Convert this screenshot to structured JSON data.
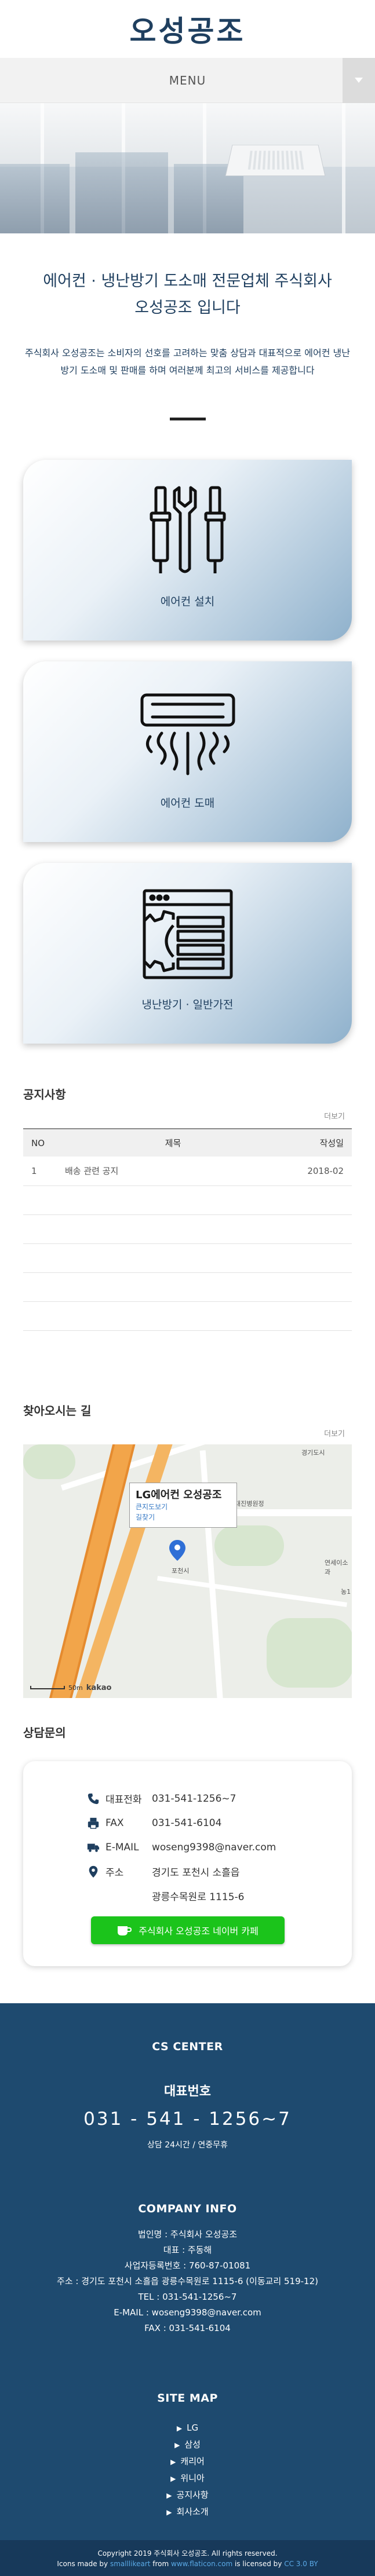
{
  "header": {
    "logo": "오성공조",
    "menu_label": "MENU"
  },
  "intro": {
    "title": "에어컨 · 냉난방기 도소매 전문업체 주식회사 오성공조 입니다",
    "description": "주식회사 오성공조는 소비자의 선호를 고려하는 맞춤 상담과 대표적으로 에어컨 냉난방기 도소매 및 판매를 하며 여러분께 최고의 서비스를 제공합니다"
  },
  "services": [
    {
      "label": "에어컨 설치",
      "icon": "tools-icon"
    },
    {
      "label": "에어컨 도매",
      "icon": "air-conditioner-icon"
    },
    {
      "label": "냉난방기 · 일반가전",
      "icon": "gear-window-icon"
    }
  ],
  "notice": {
    "title": "공지사항",
    "more": "더보기",
    "columns": {
      "no": "NO",
      "title": "제목",
      "date": "작성일"
    },
    "rows": [
      {
        "no": "1",
        "title": "배송 관련 공지",
        "date": "2018-02"
      },
      {
        "no": "",
        "title": "",
        "date": ""
      },
      {
        "no": "",
        "title": "",
        "date": ""
      },
      {
        "no": "",
        "title": "",
        "date": ""
      },
      {
        "no": "",
        "title": "",
        "date": ""
      },
      {
        "no": "",
        "title": "",
        "date": ""
      }
    ]
  },
  "location": {
    "title": "찾아오시는 길",
    "more": "더보기",
    "map": {
      "popup_title": "LG에어컨 오성공조",
      "popup_link_1": "큰지도보기",
      "popup_link_2": "길찾기",
      "places": [
        "경기도시",
        "대진병원정",
        "연세이소과",
        "농1",
        "포천시"
      ],
      "scale": "50m",
      "provider": "kakao"
    }
  },
  "contact": {
    "title": "상담문의",
    "phone_label": "대표전화",
    "phone": "031-541-1256~7",
    "fax_label": "FAX",
    "fax": "031-541-6104",
    "email_label": "E-MAIL",
    "email": "woseng9398@naver.com",
    "address_label": "주소",
    "address_1": "경기도 포천시 소흘읍",
    "address_2": "광릉수목원로 1115-6",
    "cafe_button": "주식회사 오성공조 네이버 카페"
  },
  "footer": {
    "cs_title": "CS CENTER",
    "tel_title": "대표번호",
    "tel": "031 - 541 - 1256~7",
    "hours": "상담 24시간 / 연중무휴",
    "company_title": "COMPANY INFO",
    "company_lines": [
      "법인명 : 주식회사 오성공조",
      "대표 : 주동해",
      "사업자등록번호 : 760-87-01081",
      "주소 : 경기도 포천시 소흘읍 광릉수목원로 1115-6 (이동교리 519-12)",
      "TEL : 031-541-1256~7",
      "E-MAIL : woseng9398@naver.com",
      "FAX : 031-541-6104"
    ],
    "sitemap_title": "SITE MAP",
    "sitemap": [
      "LG",
      "삼성",
      "캐리어",
      "위니아",
      "공지사항",
      "회사소개"
    ],
    "copyright": "Copyright 2019 주식회사 오성공조. All rights reserved.",
    "credit_prefix": "Icons made by ",
    "credit_author": "smalllikeart",
    "credit_from": " from ",
    "credit_site": "www.flaticon.com",
    "credit_mid": " is licensed by ",
    "credit_license": "CC 3.0 BY"
  },
  "colors": {
    "brand": "#1f3f5f",
    "footer": "#1e4a6f",
    "cafe": "#1bc41b"
  }
}
